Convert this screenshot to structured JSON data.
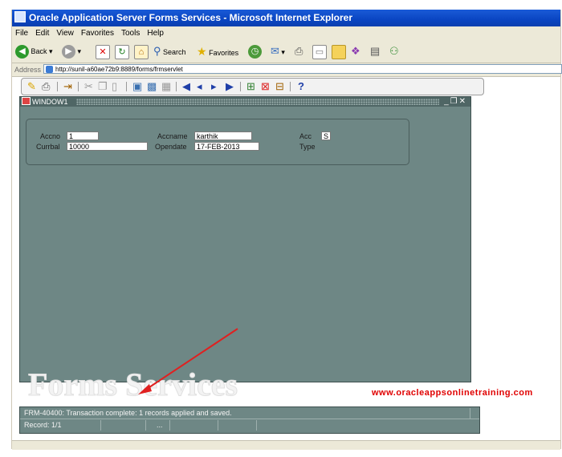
{
  "browser": {
    "title": "Oracle Application Server Forms Services - Microsoft Internet Explorer",
    "menu": [
      "File",
      "Edit",
      "View",
      "Favorites",
      "Tools",
      "Help"
    ],
    "toolbar": {
      "back_label": "Back",
      "search_label": "Search",
      "favorites_label": "Favorites"
    },
    "address_label": "Address",
    "address_url": "http://sunil-a60ae72b9:8889/forms/frmservlet"
  },
  "forms": {
    "window_title": "WINDOW1",
    "fields": {
      "accno_label": "Accno",
      "accno_value": "1",
      "accname_label": "Accname",
      "accname_value": "karthik",
      "acc_label": "Acc",
      "acc_value": "S",
      "type_label": "Type",
      "currbal_label": "Currbal",
      "currbal_value": "10000",
      "opendate_label": "Opendate",
      "opendate_value": "17-FEB-2013"
    },
    "status": {
      "message": "FRM-40400: Transaction complete: 1 records applied and saved.",
      "record": "Record: 1/1",
      "ellipsis": "..."
    }
  },
  "overlay": {
    "watermark": "Forms Services",
    "site": "www.oracleappsonlinetraining.com",
    "arrow_color": "#e02020"
  }
}
